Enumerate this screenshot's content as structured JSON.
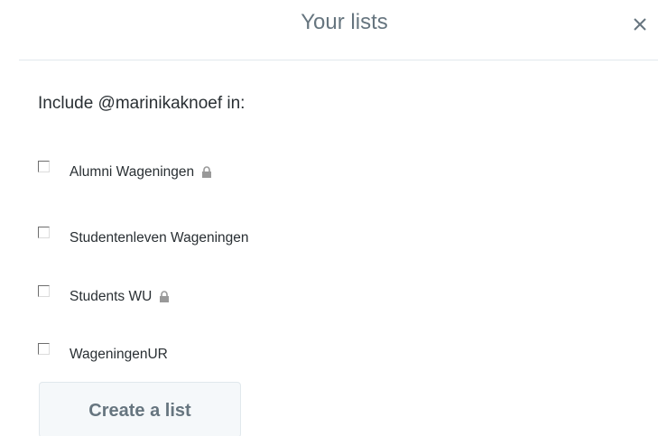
{
  "header": {
    "title": "Your lists",
    "close_icon": "close-icon"
  },
  "prompt": "Include @marinikaknoef in:",
  "lists": [
    {
      "label": "Alumni Wageningen",
      "checked": false,
      "private": true
    },
    {
      "label": "Studentenleven Wageningen",
      "checked": false,
      "private": false
    },
    {
      "label": "Students WU",
      "checked": false,
      "private": true
    },
    {
      "label": "WageningenUR",
      "checked": false,
      "private": false
    }
  ],
  "create_button": {
    "label": "Create a list"
  },
  "colors": {
    "title": "#66757f",
    "text": "#292f33",
    "divider": "#e1e8ed",
    "button_bg": "#f5f8fa",
    "lock": "#999999"
  }
}
